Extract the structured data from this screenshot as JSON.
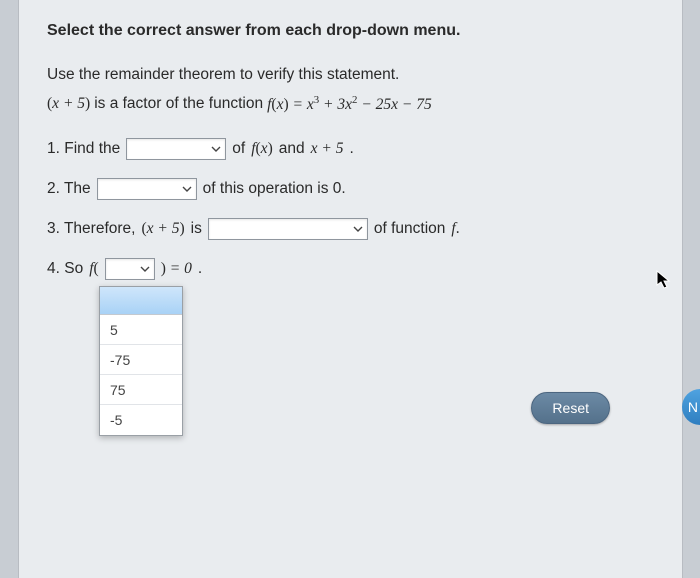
{
  "instruction": "Select the correct answer from each drop-down menu.",
  "statement_intro": "Use the remainder theorem to verify this statement.",
  "factor_expr": "(x + 5)",
  "is_factor_of": " is a factor of the function ",
  "fx_eq": "f(x) = x³ + 3x² − 25x − 75",
  "step1": {
    "pre": "1. Find the",
    "mid": "of",
    "fx": "f(x)",
    "and": "and",
    "xp5": "x + 5",
    "dot": "."
  },
  "step2": {
    "pre": "2. The",
    "post": "of this operation is 0."
  },
  "step3": {
    "pre": "3. Therefore,",
    "xp5": "(x + 5)",
    "is": "is",
    "post": "of function",
    "f": "f.",
    "dot": ""
  },
  "step4": {
    "pre": "4. So",
    "f_open": "f(",
    "close_eq": ") = 0",
    "dot": "."
  },
  "dropdown_options": [
    "",
    "5",
    "-75",
    "75",
    "-5"
  ],
  "buttons": {
    "reset": "Reset",
    "next_fragment": "N"
  }
}
